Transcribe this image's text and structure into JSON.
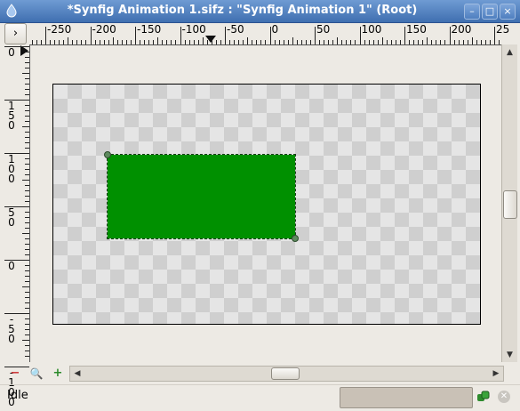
{
  "window": {
    "title": "*Synfig Animation 1.sifz : \"Synfig Animation 1\" (Root)",
    "minimize": "–",
    "maximize": "□",
    "close": "×"
  },
  "toolbar": {
    "toggle_ducks_label": "›"
  },
  "hruler": {
    "labels": [
      "-250",
      "-200",
      "-150",
      "-100",
      "-50",
      "0",
      "50",
      "100",
      "150",
      "200",
      "25"
    ]
  },
  "vruler": {
    "labels": [
      "0",
      "150",
      "100",
      "50",
      "0",
      "-50",
      "-100"
    ],
    "top_label": "0"
  },
  "zoom": {
    "minus": "−",
    "fit": "🔍",
    "plus": "+"
  },
  "status": {
    "text": "Idle"
  },
  "colors": {
    "shape_fill": "#009000",
    "titlebar": "#4f7fc0",
    "background": "#edeae4"
  },
  "icons": [
    "synfig-app-icon",
    "minimize-icon",
    "maximize-icon",
    "close-icon",
    "zoom-out-icon",
    "zoom-fit-icon",
    "zoom-in-icon",
    "animation-mode-icon",
    "stop-icon"
  ]
}
